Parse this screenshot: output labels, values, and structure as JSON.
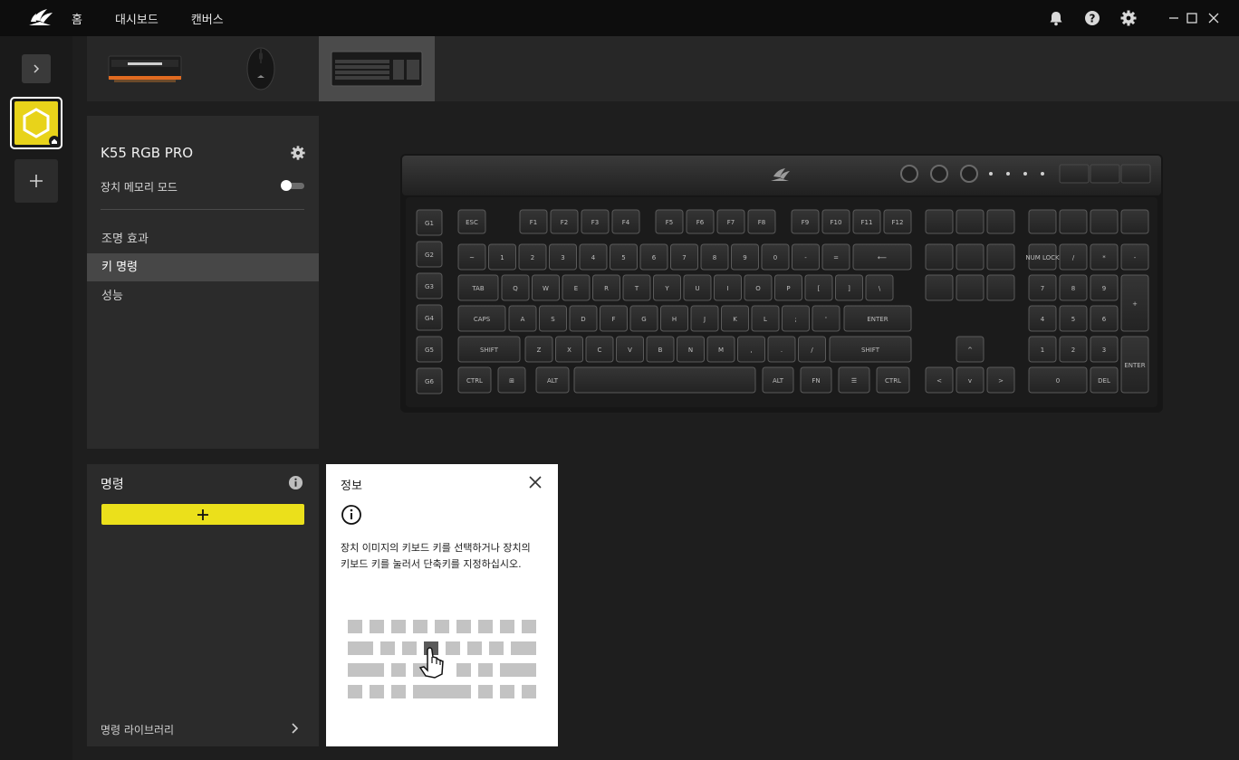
{
  "topbar": {
    "nav": [
      "홈",
      "대시보드",
      "캔버스"
    ]
  },
  "icons": {
    "logo": "corsair-sails-icon",
    "bell": "bell-icon",
    "help": "help-icon",
    "settings": "gear-icon",
    "minimize": "minimize-icon",
    "maximize": "maximize-icon",
    "close": "close-icon"
  },
  "devices": [
    "memory-module",
    "mouse",
    "keyboard"
  ],
  "device_panel": {
    "title": "K55 RGB PRO",
    "memory_mode_label": "장치 메모리 모드",
    "memory_mode_on": false,
    "menu": [
      "조명 효과",
      "키 명령",
      "성능"
    ],
    "active_menu": 1
  },
  "commands_panel": {
    "title": "명령",
    "library_label": "명령 라이브러리"
  },
  "info_popup": {
    "title": "정보",
    "line1": "장치 이미지의 키보드 키를 선택하거나 장치의",
    "line2": "키보드 키를 눌러서 단축키를 지정하십시오."
  },
  "keyboard": {
    "g_keys": [
      "G1",
      "G2",
      "G3",
      "G4",
      "G5",
      "G6"
    ],
    "fn_row": [
      "ESC",
      "F1",
      "F2",
      "F3",
      "F4",
      "F5",
      "F6",
      "F7",
      "F8",
      "F9",
      "F10",
      "F11",
      "F12"
    ],
    "num_row": [
      "~",
      "1",
      "2",
      "3",
      "4",
      "5",
      "6",
      "7",
      "8",
      "9",
      "0",
      "-",
      "="
    ],
    "q_row": [
      "TAB",
      "Q",
      "W",
      "E",
      "R",
      "T",
      "Y",
      "U",
      "I",
      "O",
      "P",
      "[",
      "]",
      "\\"
    ],
    "a_row": [
      "CAPS",
      "A",
      "S",
      "D",
      "F",
      "G",
      "H",
      "J",
      "K",
      "L",
      ";",
      "'",
      "ENTER"
    ],
    "z_row": [
      "SHIFT",
      "Z",
      "X",
      "C",
      "V",
      "B",
      "N",
      "M",
      ",",
      ".",
      "/",
      "SHIFT"
    ],
    "bottom_row": [
      "CTRL",
      "⊞",
      "ALT",
      "",
      "ALT",
      "FN",
      "☰",
      "CTRL"
    ],
    "numpad": {
      "row1": [
        "NUM LOCK",
        "/",
        "*",
        "-"
      ],
      "row2": [
        "7",
        "8",
        "9"
      ],
      "row3": [
        "4",
        "5",
        "6"
      ],
      "row4": [
        "1",
        "2",
        "3"
      ],
      "row5": [
        "0",
        "DEL"
      ],
      "plus": "+",
      "enter": "ENTER"
    }
  }
}
